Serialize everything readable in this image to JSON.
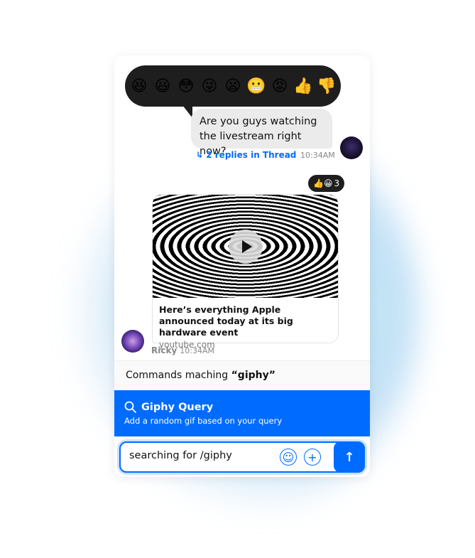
{
  "reactions": [
    "😆",
    "😃",
    "😳",
    "😜",
    "😦",
    "😬",
    "😡",
    "👍",
    "👎"
  ],
  "message1": {
    "text": "Are you guys watching the livestream right now?",
    "thread": "↳ 2 replies in Thread",
    "time": "10:34AM"
  },
  "message2": {
    "reactions": "👍😀",
    "reaction_count": "3",
    "title": "Here’s everything Apple announced today at its big hardware event",
    "source": "youtube.com",
    "author": "Ricky",
    "time": "10:34AM"
  },
  "commands": {
    "header_prefix": "Commands maching ",
    "header_query": "“giphy”",
    "item_title": "Giphy Query",
    "item_desc": "Add a random gif based on your query"
  },
  "composer": {
    "value": "searching for /giphy",
    "emoji_icon": "☺",
    "add_icon": "+",
    "send_icon": "↑"
  },
  "colors": {
    "accent": "#006cff"
  }
}
